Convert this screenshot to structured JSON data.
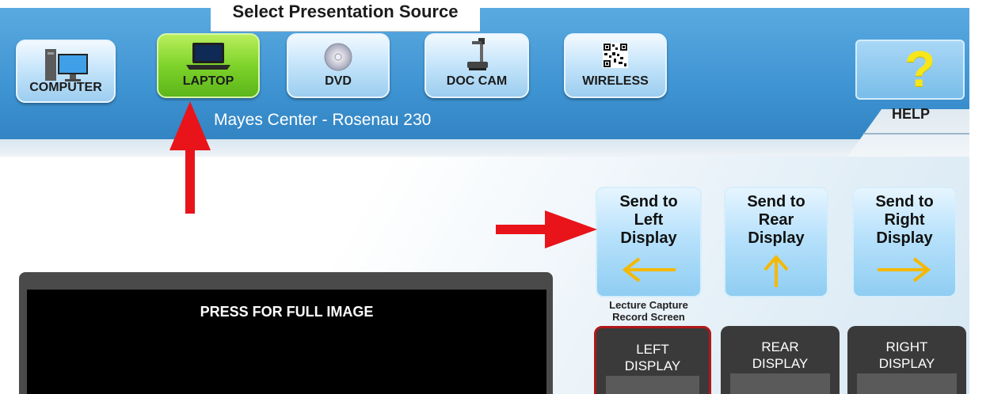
{
  "header": {
    "title": "Select Presentation Source",
    "room": "Mayes Center - Rosenau 230"
  },
  "sources": [
    {
      "label": "COMPUTER",
      "icon": "computer-icon",
      "active": false
    },
    {
      "label": "LAPTOP",
      "icon": "laptop-icon",
      "active": true
    },
    {
      "label": "DVD",
      "icon": "dvd-icon",
      "active": false
    },
    {
      "label": "DOC CAM",
      "icon": "doc-cam-icon",
      "active": false
    },
    {
      "label": "WIRELESS",
      "icon": "qr-code-icon",
      "active": false
    }
  ],
  "help": {
    "label": "HELP",
    "glyph": "?"
  },
  "send": [
    {
      "label_lines": [
        "Send to",
        "Left",
        "Display"
      ],
      "arrow": "←"
    },
    {
      "label_lines": [
        "Send to",
        "Rear",
        "Display"
      ],
      "arrow": "↑"
    },
    {
      "label_lines": [
        "Send to",
        "Right",
        "Display"
      ],
      "arrow": "→"
    }
  ],
  "lecture_capture": {
    "line1": "Lecture Capture",
    "line2": "Record Screen"
  },
  "displays": [
    {
      "line1": "LEFT",
      "line2": "DISPLAY",
      "selected": true
    },
    {
      "line1": "REAR",
      "line2": "DISPLAY",
      "selected": false
    },
    {
      "line1": "RIGHT",
      "line2": "DISPLAY",
      "selected": false
    }
  ],
  "preview": {
    "text": "PRESS FOR FULL IMAGE"
  },
  "colors": {
    "header_blue": "#3e93d2",
    "active_green": "#7ed32a",
    "arrow_yellow": "#f5b800",
    "annotation_red": "#e8141a",
    "selected_border": "#b01818"
  }
}
